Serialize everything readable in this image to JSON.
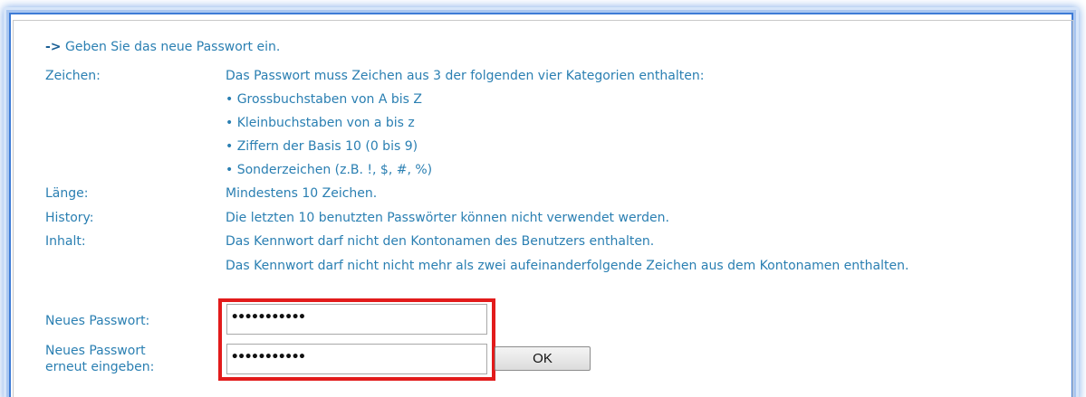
{
  "intro": {
    "arrow": "->",
    "text": "Geben Sie das neue Passwort ein."
  },
  "rules": [
    {
      "label": "Zeichen:",
      "lines": [
        "Das Passwort muss Zeichen aus 3 der folgenden vier Kategorien enthalten:",
        "• Grossbuchstaben von A bis Z",
        "• Kleinbuchstaben von a bis z",
        "• Ziffern der Basis 10 (0 bis 9)",
        "• Sonderzeichen (z.B. !, $, #, %)"
      ]
    },
    {
      "label": "Länge:",
      "lines": [
        "Mindestens 10 Zeichen."
      ]
    },
    {
      "label": "History:",
      "lines": [
        "Die letzten 10 benutzten Passwörter können nicht verwendet werden."
      ]
    },
    {
      "label": "Inhalt:",
      "lines": [
        "Das Kennwort darf nicht den Kontonamen des Benutzers enthalten.",
        "Das Kennwort darf nicht nicht mehr als zwei aufeinanderfolgende Zeichen aus dem Kontonamen enthalten."
      ]
    }
  ],
  "form": {
    "new_password_label": "Neues Passwort:",
    "new_password_value": "•••••••••••",
    "confirm_label_line1": "Neues Passwort",
    "confirm_label_line2": "erneut eingeben:",
    "confirm_password_value": "•••••••••••",
    "ok_label": "OK"
  },
  "colors": {
    "text": "#2a7fb2",
    "highlight": "#e21b1b",
    "frame": "#3d7bd6"
  }
}
